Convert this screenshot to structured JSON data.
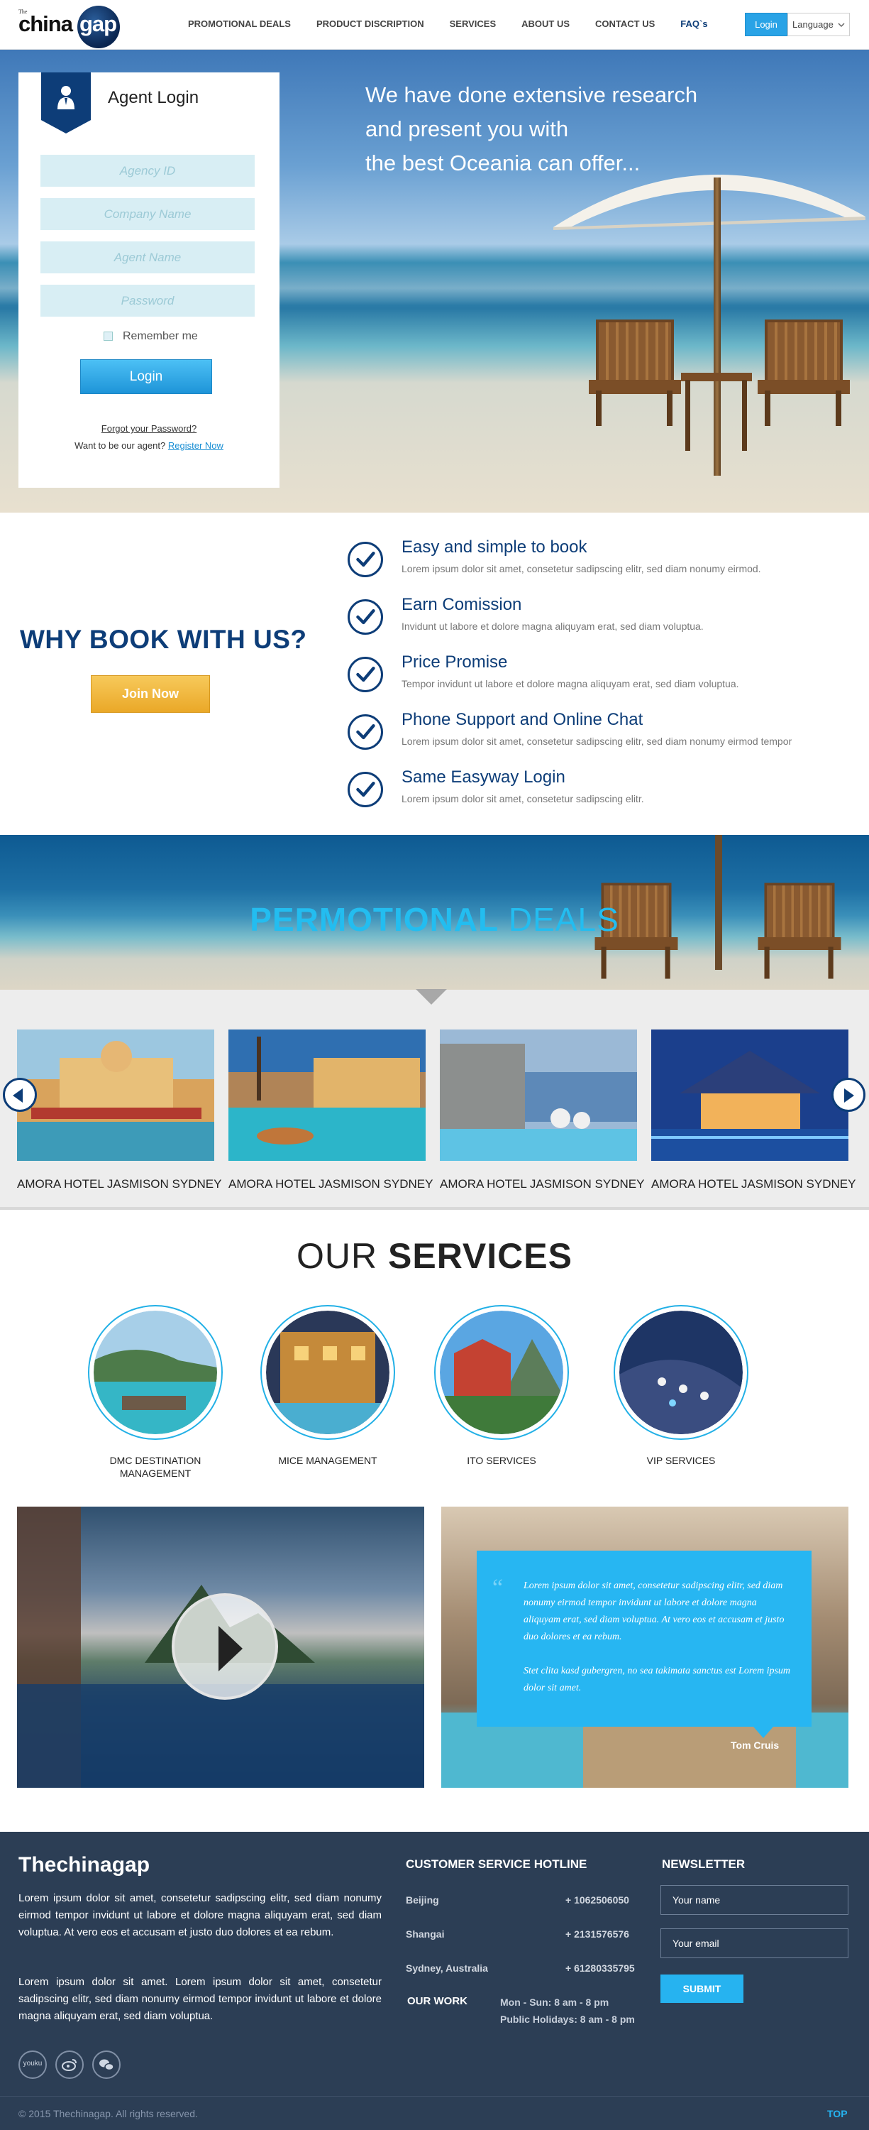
{
  "header": {
    "logo_the": "The",
    "logo_china": "china",
    "logo_gap": "gap",
    "nav": [
      "PROMOTIONAL DEALS",
      "PRODUCT DISCRIPTION",
      "SERVICES",
      "ABOUT US",
      "CONTACT US",
      "FAQ`s"
    ],
    "login_label": "Login",
    "language_label": "Language"
  },
  "hero": {
    "headline_lines": [
      "We have done extensive research",
      "and present you with",
      "the best Oceania can offer..."
    ]
  },
  "agent_login": {
    "title": "Agent Login",
    "fields": [
      "Agency ID",
      "Company Name",
      "Agent Name",
      "Password"
    ],
    "remember": "Remember me",
    "button": "Login",
    "forgot": "Forgot your Password?",
    "want_text": "Want to be our agent?",
    "register": "Register Now"
  },
  "why_book": {
    "title": "WHY BOOK WITH US?",
    "join": "Join Now",
    "features": [
      {
        "title": "Easy and simple to book",
        "desc": "Lorem ipsum dolor sit amet, consetetur sadipscing elitr, sed diam nonumy eirmod."
      },
      {
        "title": "Earn Comission",
        "desc": "Invidunt ut labore et dolore magna aliquyam erat, sed diam voluptua."
      },
      {
        "title": "Price Promise",
        "desc": "Tempor invidunt ut labore et dolore magna aliquyam erat, sed diam voluptua."
      },
      {
        "title": "Phone Support and Online Chat",
        "desc": "Lorem ipsum dolor sit amet, consetetur sadipscing elitr, sed diam nonumy eirmod tempor"
      },
      {
        "title": "Same Easyway Login",
        "desc": "Lorem ipsum dolor sit amet, consetetur sadipscing elitr."
      }
    ]
  },
  "promo": {
    "title_bold": "PERMOTIONAL",
    "title_light": " DEALS",
    "hotels": [
      "AMORA HOTEL JASMISON SYDNEY",
      "AMORA HOTEL JASMISON SYDNEY",
      "AMORA HOTEL JASMISON SYDNEY",
      "AMORA HOTEL JASMISON SYDNEY"
    ]
  },
  "services": {
    "title_light": "OUR ",
    "title_bold": "SERVICES",
    "items": [
      "DMC DESTINATION MANAGEMENT",
      "MICE MANAGEMENT",
      "ITO SERVICES",
      "VIP SERVICES"
    ]
  },
  "testimonial": {
    "quote_mark": "“",
    "paragraph1": "Lorem ipsum dolor sit amet, consetetur sadipscing elitr, sed diam nonumy eirmod tempor invidunt ut labore et dolore magna aliquyam erat, sed diam voluptua. At vero eos et accusam et justo duo dolores et ea rebum.",
    "paragraph2": "Stet clita kasd gubergren, no sea takimata sanctus est Lorem ipsum dolor sit amet.",
    "author": "Tom Cruis"
  },
  "footer": {
    "brand": "Thechinagap",
    "para1": "Lorem ipsum dolor sit amet, consetetur sadipscing elitr, sed diam nonumy eirmod tempor invidunt ut labore et dolore magna aliquyam erat, sed diam voluptua. At vero eos et accusam et justo duo dolores et ea rebum.",
    "para2": "Lorem ipsum dolor sit amet. Lorem ipsum dolor sit amet, consetetur sadipscing elitr,  sed diam nonumy eirmod tempor invidunt ut labore et dolore magna aliquyam erat, sed diam voluptua.",
    "social": [
      "youku",
      "weibo",
      "wechat"
    ],
    "hotline_title": "CUSTOMER SERVICE HOTLINE",
    "hotlines": [
      {
        "city": "Beijing",
        "phone": "+ 1062506050"
      },
      {
        "city": "Shangai",
        "phone": "+ 2131576576"
      },
      {
        "city": "Sydney, Australia",
        "phone": "+ 61280335795"
      }
    ],
    "our_work": "OUR WORK",
    "hours": [
      "Mon - Sun: 8 am - 8 pm",
      "Public Holidays: 8 am - 8 pm"
    ],
    "newsletter_title": "NEWSLETTER",
    "name_placeholder": "Your name",
    "email_placeholder": "Your email",
    "submit": "SUBMIT",
    "copyright": "© 2015 Thechinagap. All rights reserved.",
    "top": "TOP"
  },
  "colors": {
    "navy": "#0d3d78",
    "accent_blue": "#26b3f0",
    "join_gold": "#f0b53c",
    "footer_bg": "#2c3e55"
  }
}
